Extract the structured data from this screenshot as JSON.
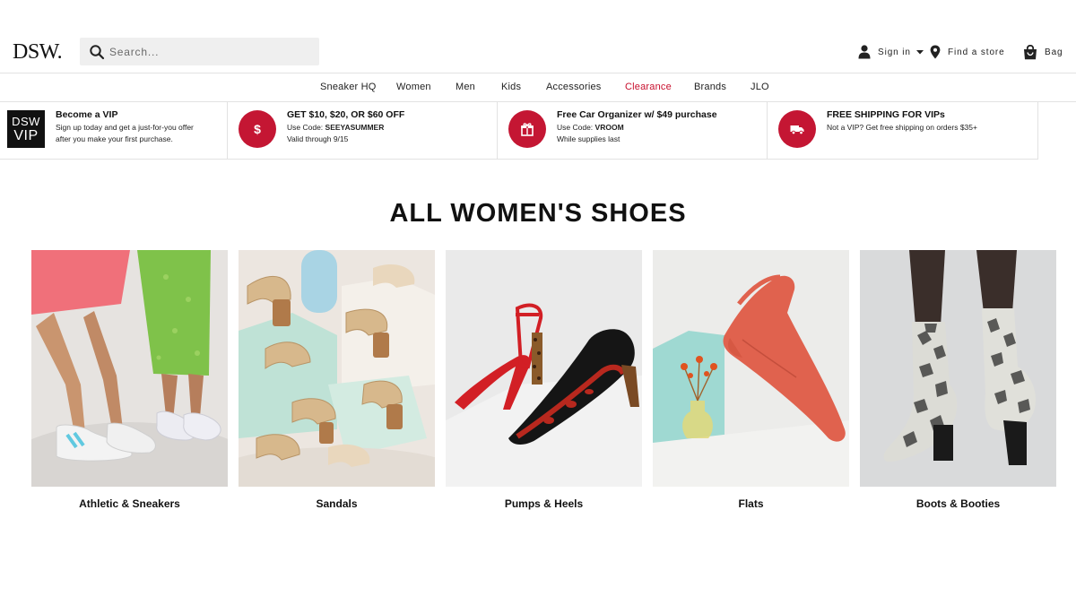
{
  "brand": {
    "logo": "DSW."
  },
  "search": {
    "placeholder": "Search..."
  },
  "utility": {
    "signin_label": "Sign in",
    "store_label": "Find a store",
    "bag_label": "Bag",
    "icons": [
      "person-icon",
      "caret-down-icon",
      "location-pin-icon",
      "shopping-bag-icon"
    ]
  },
  "nav": {
    "items": [
      "Sneaker HQ",
      "Women",
      "Men",
      "Kids",
      "Accessories",
      "Clearance",
      "Brands",
      "JLO"
    ],
    "highlight_color": "#c8102e"
  },
  "promos": {
    "vip": {
      "badge_top": "DSW",
      "badge_bottom": "VIP",
      "title": "Become a VIP",
      "line1": "Sign up today and get a just-for-you offer",
      "line2": "after you make your first purchase."
    },
    "discount": {
      "title": "GET $10, $20, OR $60 OFF",
      "code_prefix": "Use Code:",
      "code": "SEEYASUMMER",
      "line2": "Valid through 9/15",
      "icon": "dollar-icon"
    },
    "gift": {
      "title": "Free Car Organizer w/ $49 purchase",
      "code_prefix": "Use Code:",
      "code": "VROOM",
      "line2": "While supplies last",
      "icon": "gift-icon"
    },
    "shipping": {
      "title": "FREE SHIPPING FOR VIPs",
      "line1": "Not a VIP? Get free shipping on orders $35+",
      "icon": "truck-icon"
    },
    "accent_color": "#c41633"
  },
  "page": {
    "title": "ALL WOMEN'S SHOES"
  },
  "categories": [
    {
      "label": "Athletic & Sneakers"
    },
    {
      "label": "Sandals"
    },
    {
      "label": "Pumps & Heels"
    },
    {
      "label": "Flats"
    },
    {
      "label": "Boots & Booties"
    }
  ]
}
